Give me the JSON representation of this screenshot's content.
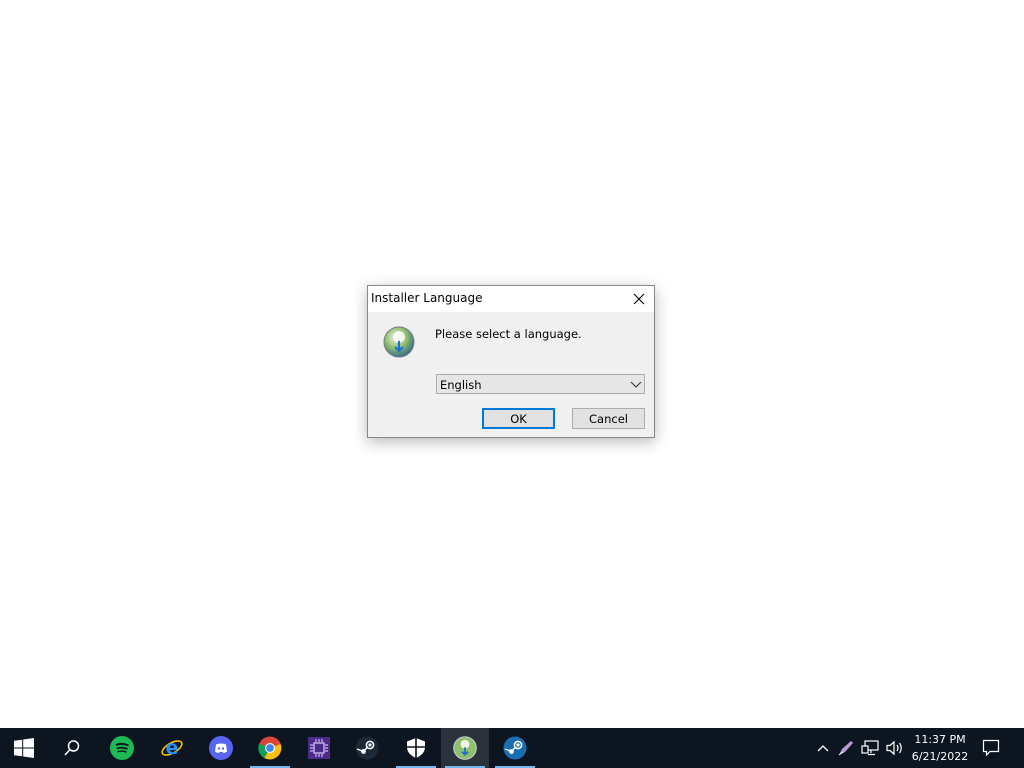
{
  "dialog": {
    "title": "Installer Language",
    "prompt": "Please select a language.",
    "language_select": {
      "selected": "English"
    },
    "ok_label": "OK",
    "cancel_label": "Cancel"
  },
  "taskbar": {
    "apps": [
      {
        "name": "start",
        "icon": "windows-logo-icon"
      },
      {
        "name": "search",
        "icon": "search-icon"
      },
      {
        "name": "spotify",
        "icon": "spotify-icon",
        "color": "#1db954"
      },
      {
        "name": "internet-explorer",
        "icon": "ie-icon",
        "color": "#1e90ff"
      },
      {
        "name": "discord",
        "icon": "discord-icon",
        "color": "#5865f2"
      },
      {
        "name": "chrome",
        "icon": "chrome-icon"
      },
      {
        "name": "app-purple",
        "icon": "chip-icon",
        "color": "#4b2a8a"
      },
      {
        "name": "steam",
        "icon": "steam-icon"
      },
      {
        "name": "security",
        "icon": "shield-icon"
      },
      {
        "name": "installer",
        "icon": "installer-icon"
      },
      {
        "name": "steam-2",
        "icon": "steam-icon"
      }
    ],
    "tray": [
      "chevron-up-icon",
      "pen-icon",
      "network-icon",
      "volume-icon"
    ],
    "clock": {
      "time": "11:37 PM",
      "date": "6/21/2022"
    }
  },
  "colors": {
    "taskbar": "#0c1520",
    "focus": "#0078d7",
    "accent_underline": "#76b9ed"
  }
}
